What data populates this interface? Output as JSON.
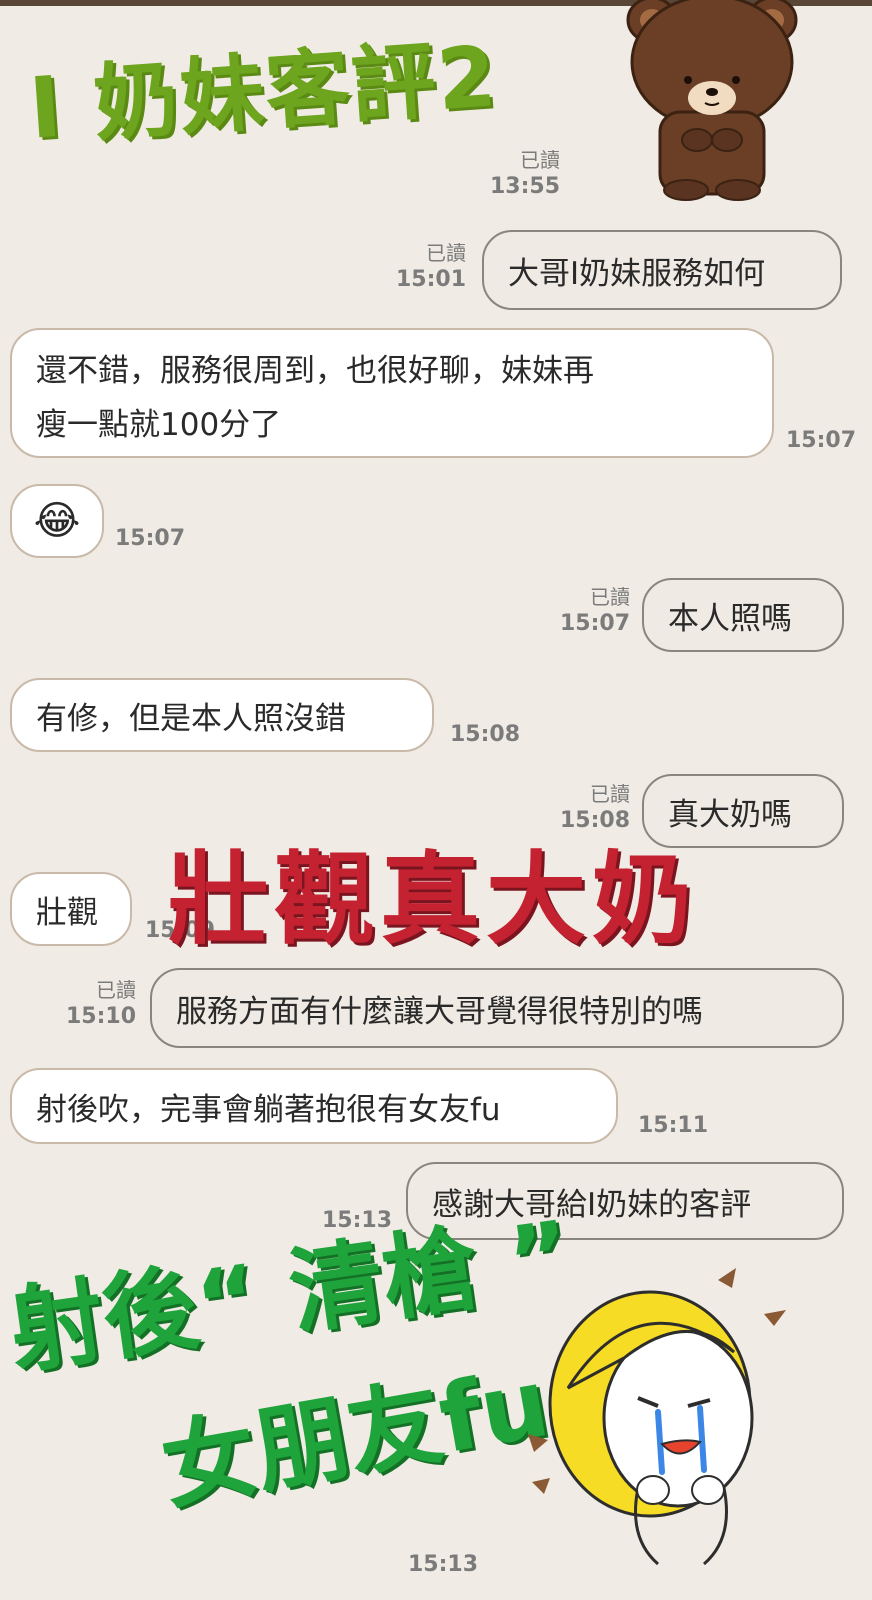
{
  "headline": "I 奶妹客評2",
  "top_receipt": {
    "read": "已讀",
    "time": "13:55"
  },
  "messages": [
    {
      "side": "out",
      "text": "大哥I奶妹服務如何",
      "read": "已讀",
      "time": "15:01"
    },
    {
      "side": "in",
      "line1": "還不錯，服務很周到，也很好聊，妹妹再",
      "line2": "瘦一點就100分了",
      "time": "15:07"
    },
    {
      "side": "in",
      "emoji": "😂",
      "time": "15:07"
    },
    {
      "side": "out",
      "text": "本人照嗎",
      "read": "已讀",
      "time": "15:07"
    },
    {
      "side": "in",
      "text": "有修，但是本人照沒錯",
      "time": "15:08"
    },
    {
      "side": "out",
      "text": "真大奶嗎",
      "read": "已讀",
      "time": "15:08"
    },
    {
      "side": "in",
      "text": "壯觀",
      "time": "15:09"
    },
    {
      "side": "out",
      "text": "服務方面有什麼讓大哥覺得很特別的嗎",
      "read": "已讀",
      "time": "15:10"
    },
    {
      "side": "in",
      "text": "射後吹，完事會躺著抱很有女友fu",
      "time": "15:11"
    },
    {
      "side": "out",
      "text": "感謝大哥給I奶妹的客評",
      "time": "15:13"
    }
  ],
  "overlay_red": "壯觀真大奶",
  "overlay_green_line1": "射後“ 清槍 ”",
  "overlay_green_line2": "女朋友fu",
  "bottom_time": "15:13",
  "colors": {
    "background": "#f0ebe4",
    "headline_green": "#6ea51e",
    "overlay_red": "#c42230",
    "overlay_green": "#1fa33b",
    "meta_gray": "#7b7b7b"
  },
  "stickers": [
    "brown-bear-sticker",
    "crying-blonde-girl-sticker"
  ]
}
